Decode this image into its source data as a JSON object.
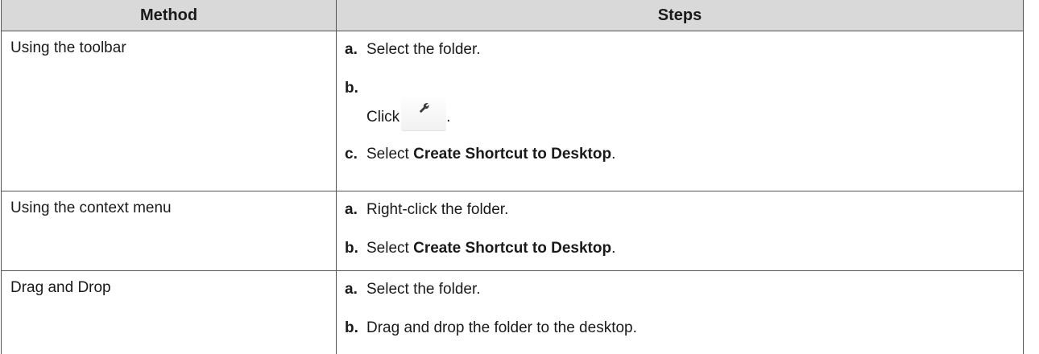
{
  "table": {
    "headers": {
      "method": "Method",
      "steps": "Steps"
    },
    "rows": [
      {
        "method": "Using the toolbar",
        "steps": [
          {
            "letter": "a.",
            "text": "Select the folder."
          },
          {
            "letter": "b.",
            "prefix": "Click",
            "icon": "wrench-icon",
            "suffix": "."
          },
          {
            "letter": "c.",
            "prefix": "Select ",
            "bold": "Create Shortcut to Desktop",
            "suffix": "."
          }
        ]
      },
      {
        "method": "Using the context menu",
        "steps": [
          {
            "letter": "a.",
            "text": "Right-click the folder."
          },
          {
            "letter": "b.",
            "prefix": "Select ",
            "bold": "Create Shortcut to Desktop",
            "suffix": "."
          }
        ]
      },
      {
        "method": "Drag and Drop",
        "steps": [
          {
            "letter": "a.",
            "text": "Select the folder."
          },
          {
            "letter": "b.",
            "text": "Drag and drop the folder to the desktop."
          }
        ]
      }
    ]
  },
  "colors": {
    "header_bg": "#d9d9d9",
    "border": "#555555",
    "text": "#1a1a1a"
  }
}
